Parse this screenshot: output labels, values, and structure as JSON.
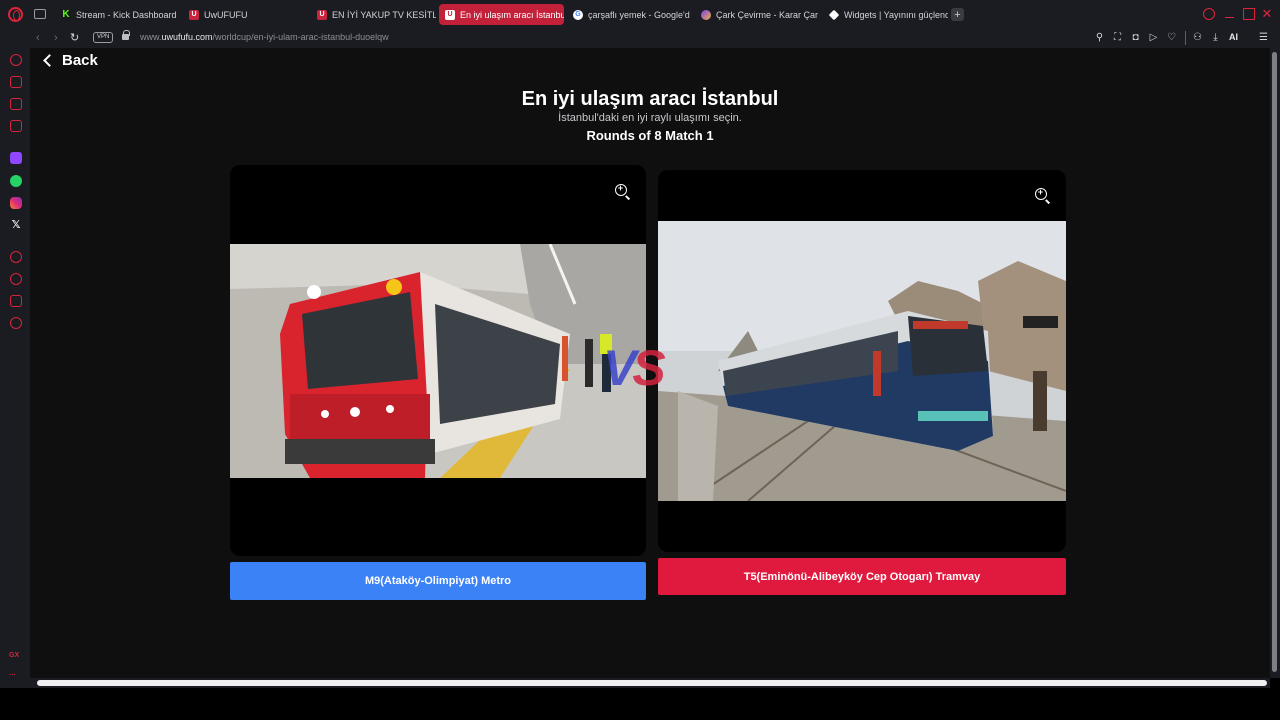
{
  "browser": {
    "tabs": [
      {
        "title": "Stream - Kick Dashboard",
        "icon": "kick-icon"
      },
      {
        "title": "UwUFUFU",
        "icon": "uwufufu-icon"
      },
      {
        "title": "EN İYİ YAKUP TV KESİTLE",
        "icon": "uwufufu-icon"
      },
      {
        "title": "En iyi ulaşım aracı İstanbul",
        "icon": "uwufufu-icon",
        "active": true
      },
      {
        "title": "çarşaflı yemek - Google'd",
        "icon": "google-icon"
      },
      {
        "title": "Çark Çevirme - Karar Çar",
        "icon": "wheel-icon"
      },
      {
        "title": "Widgets | Yayınını güçlend",
        "icon": "widget-icon"
      }
    ],
    "new_tab": "+",
    "address": {
      "vpn": "VPN",
      "url_prefix": "www.",
      "url_domain": "uwufufu.com",
      "url_path": "/worldcup/en-iyi-ulam-arac-istanbul-duoelqw"
    },
    "ai_label": "AI",
    "sidebar_footer": "GX",
    "sidebar_more": "···"
  },
  "page": {
    "back_label": "Back",
    "title": "En iyi ulaşım aracı İstanbul",
    "subtitle": "İstanbul'daki en iyi raylı ulaşımı seçin.",
    "round_info": "Rounds of 8 Match 1",
    "vs_v": "V",
    "vs_s": "S",
    "left_choice": {
      "label": "M9(Ataköy-Olimpiyat) Metro",
      "color": "#3b82f6"
    },
    "right_choice": {
      "label": "T5(Eminönü-Alibeyköy Cep Otogarı) Tramvay",
      "color": "#e0193f"
    }
  }
}
